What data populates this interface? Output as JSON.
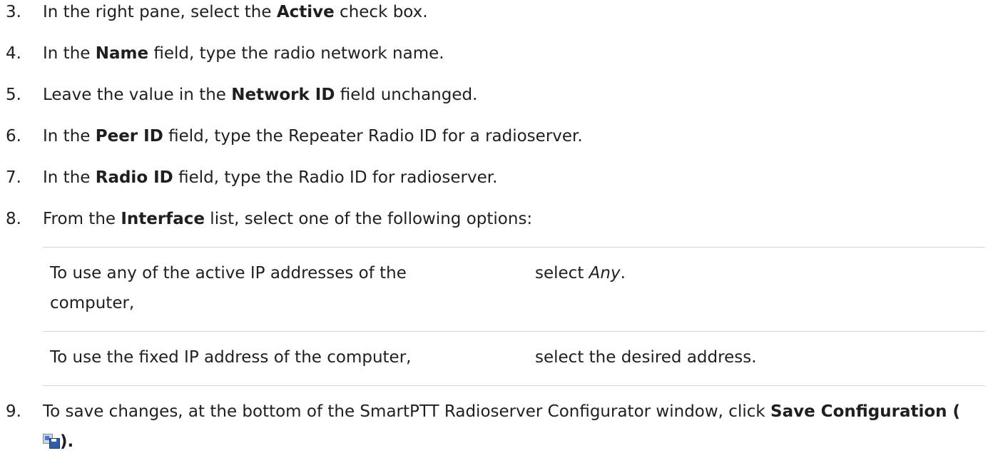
{
  "steps": [
    {
      "num": "3.",
      "pre": "In the right pane, select the ",
      "bold": "Active",
      "post": " check box."
    },
    {
      "num": "4.",
      "pre": "In the ",
      "bold": "Name",
      "post": " field, type the radio network name."
    },
    {
      "num": "5.",
      "pre": "Leave the value in the ",
      "bold": "Network ID",
      "post": " field unchanged."
    },
    {
      "num": "6.",
      "pre": "In the ",
      "bold": "Peer ID",
      "post": " field, type the Repeater Radio ID for a radioserver."
    },
    {
      "num": "7.",
      "pre": "In the ",
      "bold": "Radio ID",
      "post": " field, type the Radio ID for radioserver."
    },
    {
      "num": "8.",
      "pre": "From the ",
      "bold": "Interface",
      "post": " list, select one of the following options:"
    }
  ],
  "options_table": [
    {
      "condition_line1": "To use any of the active IP addresses of the",
      "condition_line2": "computer,",
      "action_pre": "select ",
      "action_italic": "Any",
      "action_post": "."
    },
    {
      "condition_line1": "To use the fixed IP address of the computer,",
      "action_pre": "select the desired address."
    }
  ],
  "step9": {
    "num": "9.",
    "pre": "To save changes, at the bottom of the SmartPTT Radioserver Configurator window, click ",
    "bold": "Save Configuration (",
    "close": ").",
    "icon": "save-configuration-icon"
  }
}
